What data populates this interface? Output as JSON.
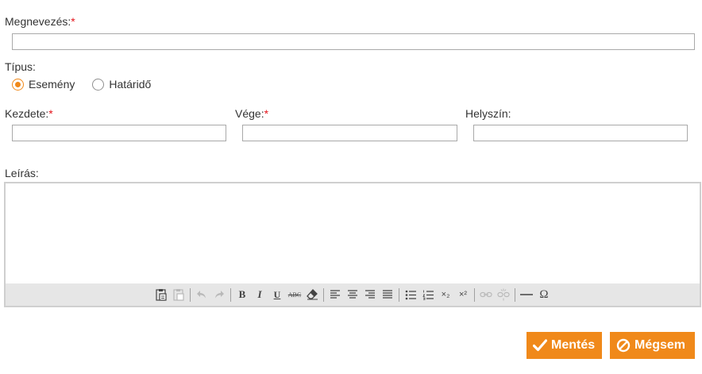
{
  "form": {
    "name_label": "Megnevezés:",
    "required_mark": "*",
    "name_value": "",
    "type_label": "Típus:",
    "type_options": [
      {
        "label": "Esemény",
        "checked": true
      },
      {
        "label": "Határidő",
        "checked": false
      }
    ],
    "start_label": "Kezdete:",
    "end_label": "Vége:",
    "location_label": "Helyszín:",
    "start_value": "",
    "end_value": "",
    "location_value": "",
    "description_label": "Leírás:"
  },
  "editor": {
    "toolbar": [
      "paste-icon",
      "paste-text-icon",
      "undo-icon",
      "redo-icon",
      "bold-icon",
      "italic-icon",
      "underline-icon",
      "strikethrough-icon",
      "remove-format-icon",
      "align-left-icon",
      "align-center-icon",
      "align-right-icon",
      "align-justify-icon",
      "bulleted-list-icon",
      "numbered-list-icon",
      "subscript-icon",
      "superscript-icon",
      "link-icon",
      "unlink-icon",
      "horizontal-line-icon",
      "special-char-icon"
    ],
    "bold_glyph": "B",
    "italic_glyph": "I",
    "underline_glyph": "U",
    "strike_glyph": "ABC",
    "subscript_glyph": "×₂",
    "superscript_glyph": "×²",
    "omega_glyph": "Ω"
  },
  "buttons": {
    "save_label": "Mentés",
    "cancel_label": "Mégsem"
  },
  "colors": {
    "accent": "#f0891a",
    "required": "#e4141b",
    "toolbar_bg": "#e6e6e6"
  }
}
